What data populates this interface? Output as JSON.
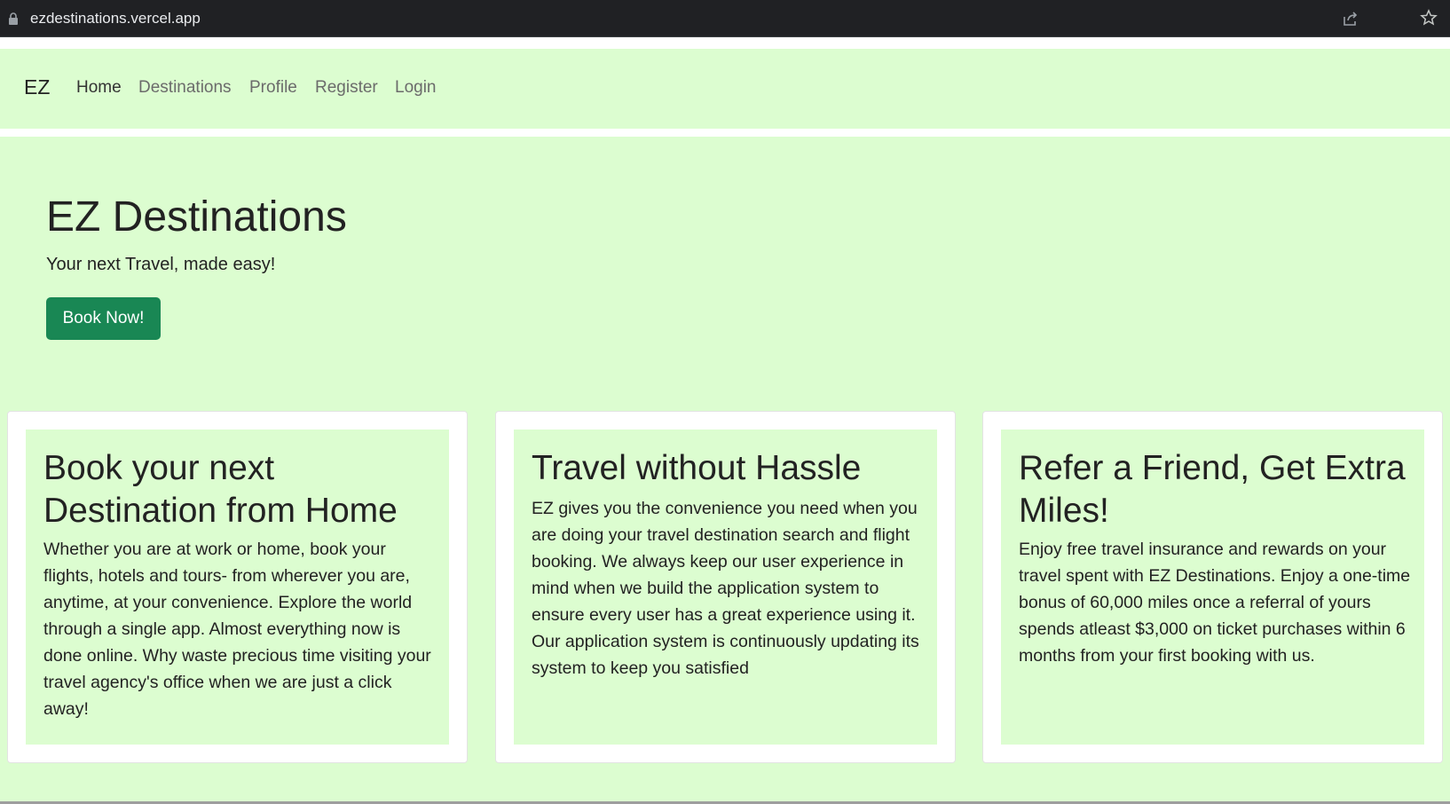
{
  "browser": {
    "url": "ezdestinations.vercel.app",
    "icons": [
      "lock-icon",
      "share-icon",
      "star-icon"
    ]
  },
  "nav": {
    "brand": "EZ",
    "links": [
      "Home",
      "Destinations",
      "Profile",
      "Register",
      "Login"
    ]
  },
  "hero": {
    "title": "EZ Destinations",
    "subtitle": "Your next Travel, made easy!",
    "button": "Book Now!"
  },
  "cards": [
    {
      "title": "Book your next Destination from Home",
      "text": "Whether you are at work or home, book your flights, hotels and tours- from wherever you are, anytime, at your convenience. Explore the world through a single app. Almost everything now is done online. Why waste precious time visiting your travel agency's office when we are just a click away!"
    },
    {
      "title": "Travel without Hassle",
      "text": "EZ gives you the convenience you need when you are doing your travel destination search and flight booking. We always keep our user experience in mind when we build the application system to ensure every user has a great experience using it. Our application system is continuously updating its system to keep you satisfied"
    },
    {
      "title": "Refer a Friend, Get Extra Miles!",
      "text": "Enjoy free travel insurance and rewards on your travel spent with EZ Destinations. Enjoy a one-time bonus of 60,000 miles once a referral of yours spends atleast $3,000 on ticket purchases within 6 months from your first booking with us."
    }
  ],
  "colors": {
    "page_bg": "#dcfdd0",
    "button_bg": "#198754",
    "urlbar_bg": "#202124"
  }
}
